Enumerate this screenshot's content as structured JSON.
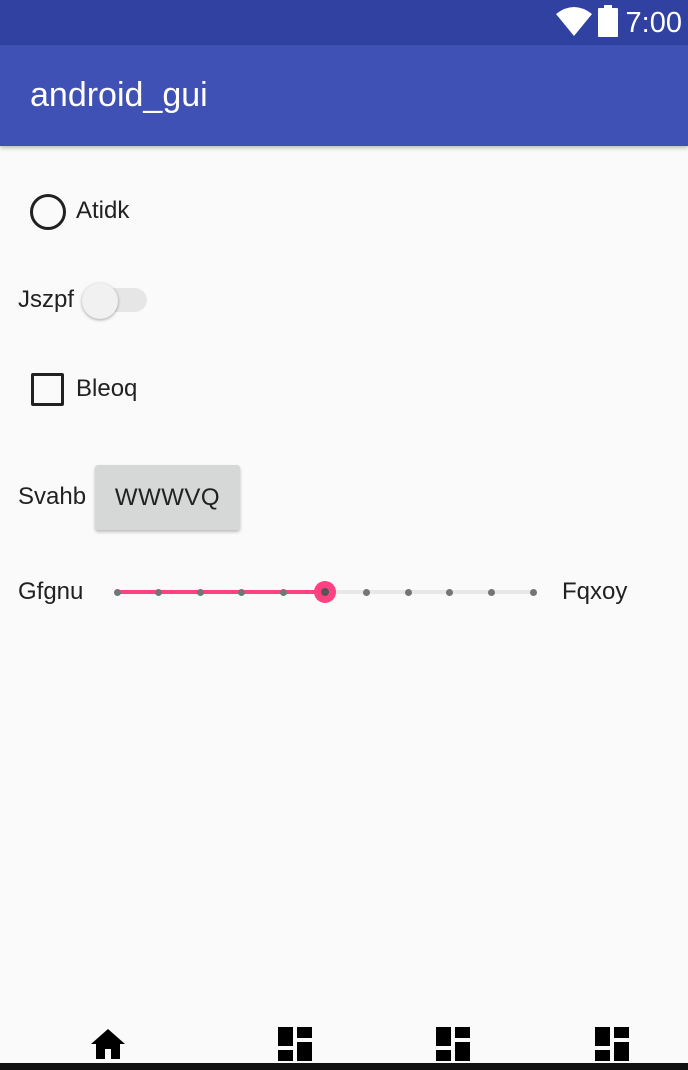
{
  "status_bar": {
    "time": "7:00",
    "icons": [
      "wifi-icon",
      "battery-icon"
    ]
  },
  "app_bar": {
    "title": "android_gui"
  },
  "form": {
    "radio_label": "Atidk",
    "switch_label": "Jszpf",
    "checkbox_label": "Bleoq",
    "button_row_label": "Svahb",
    "button_label": "WWWVQ",
    "seekbar_left_label": "Gfgnu",
    "seekbar_right_label": "Fqxoy",
    "seekbar_max": 10,
    "seekbar_value": 5
  },
  "bottom_nav": {
    "items": [
      "home-icon",
      "dashboard-icon",
      "dashboard-icon",
      "dashboard-icon"
    ]
  },
  "colors": {
    "status_bar": "#3041a1",
    "app_bar": "#3f51b5",
    "accent": "#ff4081"
  }
}
